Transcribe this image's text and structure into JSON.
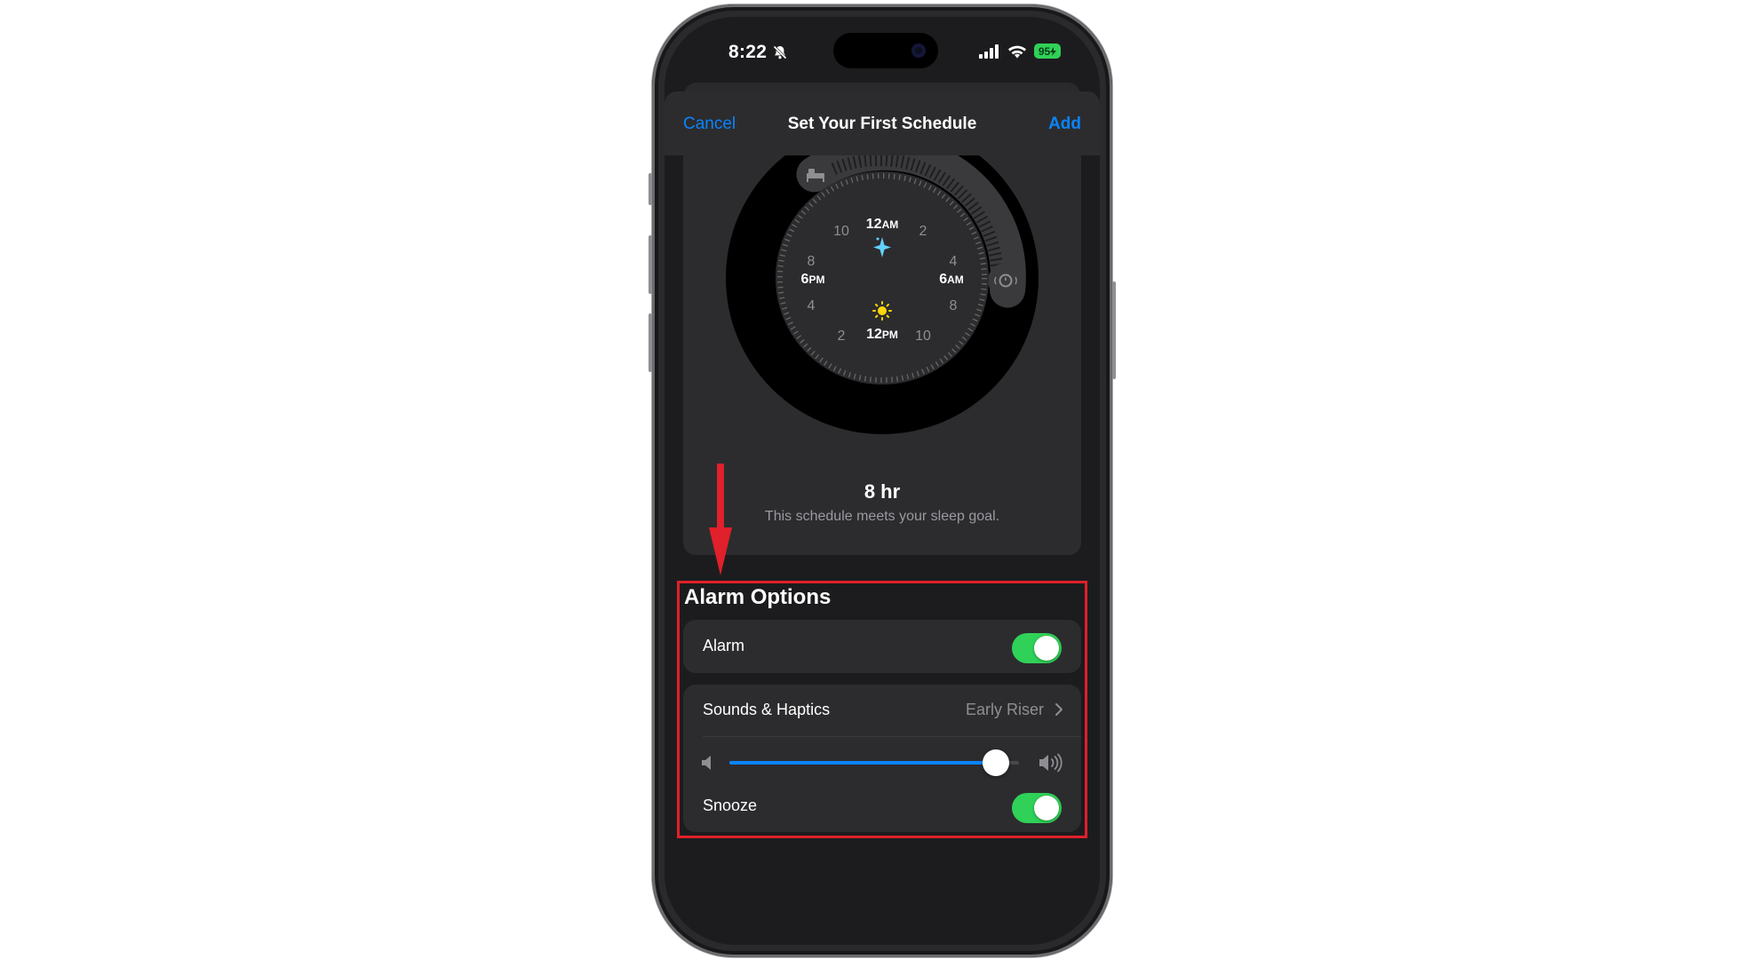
{
  "status_bar": {
    "time": "8:22",
    "battery": "95"
  },
  "navbar": {
    "cancel": "Cancel",
    "title": "Set Your First Schedule",
    "add": "Add"
  },
  "clock": {
    "labels": {
      "top": "12",
      "top_suffix": "AM",
      "right": "6",
      "right_suffix": "AM",
      "bottom": "12",
      "bottom_suffix": "PM",
      "left": "6",
      "left_suffix": "PM",
      "h2a": "2",
      "h4a": "4",
      "h8a": "8",
      "h10a": "10",
      "h2b": "2",
      "h4b": "4",
      "h8b": "8",
      "h10b": "10"
    },
    "bedtime_icon": "bed-icon",
    "wake_icon": "alarm-clock-icon"
  },
  "summary": {
    "duration": "8 hr",
    "goal_text": "This schedule meets your sleep goal."
  },
  "alarm_options": {
    "title": "Alarm Options",
    "alarm_label": "Alarm",
    "alarm_on": true,
    "sounds_label": "Sounds & Haptics",
    "sounds_value": "Early Riser",
    "volume_level": 0.92,
    "snooze_label": "Snooze",
    "snooze_on": true
  },
  "colors": {
    "accent": "#0a84ff",
    "toggle_on": "#30d158",
    "highlight": "#e0202a",
    "sleep_star": "#64d2ff",
    "sun": "#ffd60a"
  }
}
